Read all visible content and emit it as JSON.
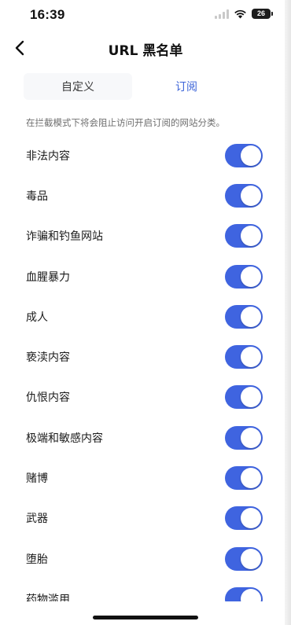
{
  "status": {
    "time": "16:39",
    "battery": "26"
  },
  "nav": {
    "title": "URL 黑名单"
  },
  "tabs": [
    {
      "label": "自定义"
    },
    {
      "label": "订阅"
    }
  ],
  "description": "在拦截模式下将会阻止访问开启订阅的网站分类。",
  "categories": [
    {
      "label": "非法内容",
      "enabled": true
    },
    {
      "label": "毒品",
      "enabled": true
    },
    {
      "label": "诈骗和钓鱼网站",
      "enabled": true
    },
    {
      "label": "血腥暴力",
      "enabled": true
    },
    {
      "label": "成人",
      "enabled": true
    },
    {
      "label": "亵渎内容",
      "enabled": true
    },
    {
      "label": "仇恨内容",
      "enabled": true
    },
    {
      "label": "极端和敏感内容",
      "enabled": true
    },
    {
      "label": "赌博",
      "enabled": true
    },
    {
      "label": "武器",
      "enabled": true
    },
    {
      "label": "堕胎",
      "enabled": true
    },
    {
      "label": "药物滥用",
      "enabled": true
    }
  ],
  "colors": {
    "accent": "#3f64e0",
    "active_tab_text": "#3b63d8"
  }
}
